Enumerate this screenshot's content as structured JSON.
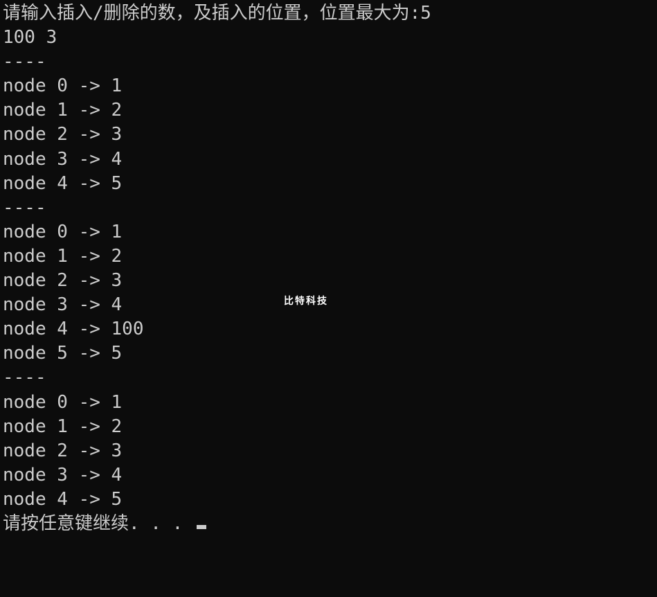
{
  "prompt": "请输入插入/删除的数，及插入的位置，位置最大为:5",
  "input": "100 3",
  "sep": "----",
  "block1": {
    "l0": "node 0 -> 1",
    "l1": "node 1 -> 2",
    "l2": "node 2 -> 3",
    "l3": "node 3 -> 4",
    "l4": "node 4 -> 5"
  },
  "block2": {
    "l0": "node 0 -> 1",
    "l1": "node 1 -> 2",
    "l2": "node 2 -> 3",
    "l3": "node 3 -> 4",
    "l4": "node 4 -> 100",
    "l5": "node 5 -> 5"
  },
  "block3": {
    "l0": "node 0 -> 1",
    "l1": "node 1 -> 2",
    "l2": "node 2 -> 3",
    "l3": "node 3 -> 4",
    "l4": "node 4 -> 5"
  },
  "continuePrompt": "请按任意键继续. . . ",
  "watermark": "比特科技"
}
